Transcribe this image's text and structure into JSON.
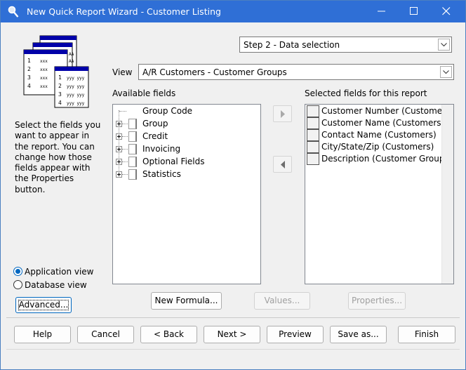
{
  "window": {
    "title": "New Quick Report Wizard - Customer Listing",
    "accent": "#2f6fd6"
  },
  "step_select": {
    "value": "Step 2 - Data selection"
  },
  "view": {
    "label": "View",
    "value": "A/R Customers - Customer Groups"
  },
  "available": {
    "header": "Available fields",
    "items": [
      {
        "label": "Group Code",
        "expandable": false
      },
      {
        "label": "Group",
        "expandable": true
      },
      {
        "label": "Credit",
        "expandable": true
      },
      {
        "label": "Invoicing",
        "expandable": true
      },
      {
        "label": "Optional Fields",
        "expandable": true
      },
      {
        "label": "Statistics",
        "expandable": true
      }
    ]
  },
  "selected": {
    "header": "Selected fields for this report",
    "items": [
      "Customer Number (Customers)",
      "Customer Name (Customers)",
      "Contact Name (Customers)",
      "City/State/Zip (Customers)",
      "Description (Customer Groups)"
    ]
  },
  "description": "Select the fields you want to appear in the report. You can change how those fields appear with the Properties button.",
  "view_mode": {
    "options": [
      "Application view",
      "Database view"
    ],
    "selected": "Application view"
  },
  "buttons": {
    "advanced": "Advanced...",
    "new_formula": "New Formula...",
    "values": "Values...",
    "properties": "Properties...",
    "help": "Help",
    "cancel": "Cancel",
    "back": "< Back",
    "next": "Next >",
    "preview": "Preview",
    "save_as": "Save as...",
    "finish": "Finish"
  },
  "icons": {
    "app": "magnifier-icon",
    "wizard": "report-pages-icon",
    "add": "arrow-right-icon",
    "remove": "arrow-left-icon"
  }
}
